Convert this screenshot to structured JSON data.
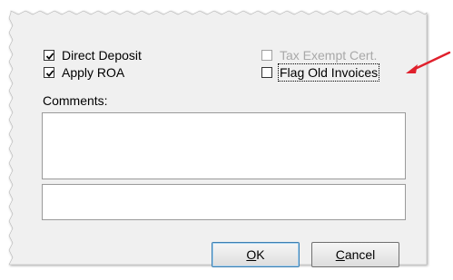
{
  "dialog": {
    "checkboxes": {
      "direct_deposit": {
        "label": "Direct Deposit",
        "checked": true,
        "enabled": true
      },
      "apply_roa": {
        "label": "Apply ROA",
        "checked": true,
        "enabled": true
      },
      "tax_exempt_cert": {
        "label": "Tax Exempt Cert.",
        "checked": false,
        "enabled": false
      },
      "flag_old_invoices": {
        "label": "Flag Old Invoices",
        "checked": false,
        "enabled": true
      }
    },
    "comments": {
      "label": "Comments:",
      "value": "",
      "second_value": ""
    },
    "buttons": {
      "ok": {
        "label": "OK",
        "mnemonic": "O",
        "rest": "K"
      },
      "cancel": {
        "label": "Cancel",
        "mnemonic": "C",
        "rest": "ancel"
      }
    }
  },
  "annotation": {
    "arrow_color": "#e0202c",
    "points_to": "flag_old_invoices"
  },
  "colors": {
    "dialog_bg": "#f0f0f0",
    "disabled_text": "#a8a8a8",
    "default_button_border": "#3c7fb1"
  }
}
